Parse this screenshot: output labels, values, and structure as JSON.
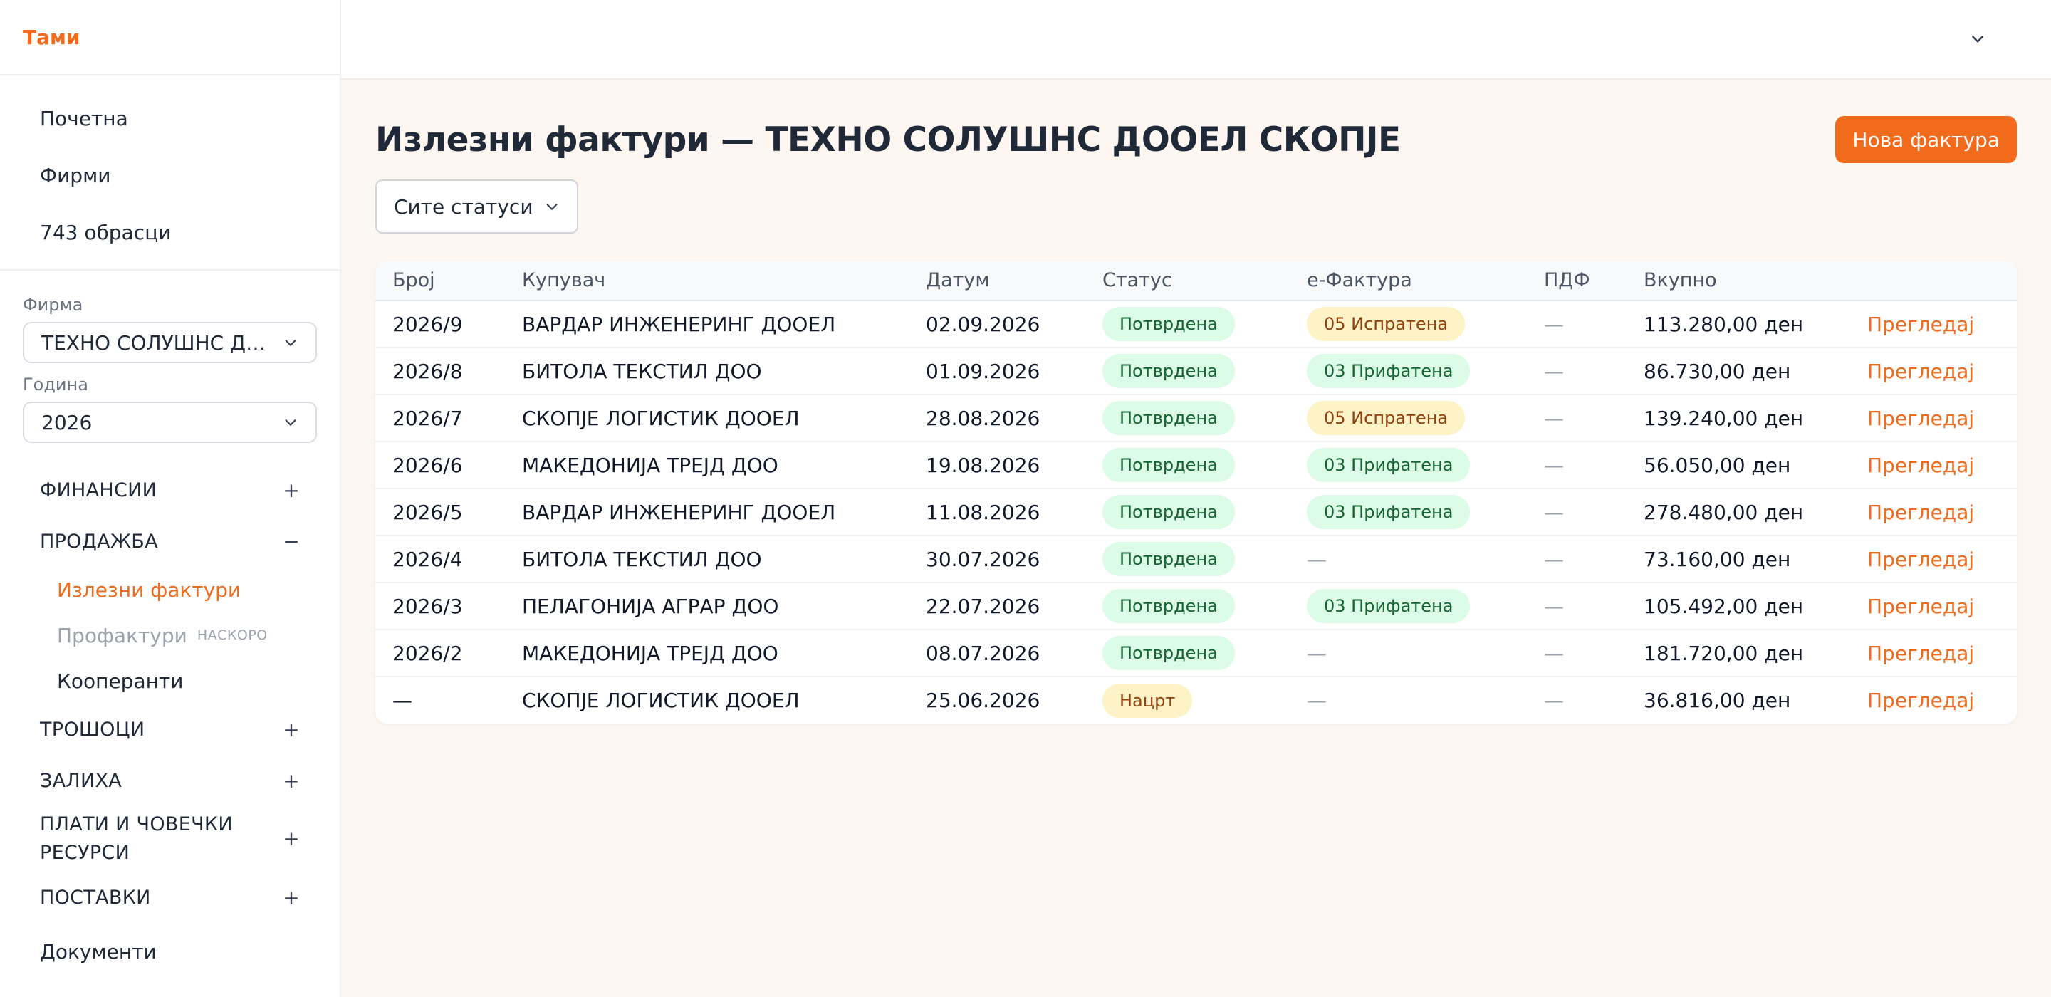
{
  "brand": "Тами",
  "nav": {
    "home": "Почетна",
    "companies": "Фирми",
    "forms": "743 обрасци"
  },
  "filters": {
    "company_label": "Фирма",
    "company_value": "ТЕХНО СОЛУШНС ДООЕЛ СКОПЈЕ",
    "year_label": "Година",
    "year_value": "2026"
  },
  "sections": {
    "finance": "ФИНАНСИИ",
    "sales": "ПРОДАЖБА",
    "expenses": "ТРОШОЦИ",
    "inventory": "ЗАЛИХА",
    "payroll": "ПЛАТИ И ЧОВЕЧКИ РЕСУРСИ",
    "supplies": "ПОСТАВКИ",
    "plus": "+",
    "minus": "−"
  },
  "sales_items": {
    "outgoing": "Излезни фактури",
    "proforma": "Профактури",
    "soon": "НАСКОРО",
    "partners": "Кооперанти"
  },
  "documents": "Документи",
  "main": {
    "title": "Излезни фактури — ТЕХНО СОЛУШНС ДООЕЛ СКОПЈЕ",
    "new_button": "Нова фактура",
    "status_filter": "Сите статуси"
  },
  "table": {
    "columns": [
      "Број",
      "Купувач",
      "Датум",
      "Статус",
      "е-Фактура",
      "ПДФ",
      "Вкупно",
      ""
    ],
    "rows": [
      {
        "number": "2026/9",
        "buyer": "ВАРДАР ИНЖЕНЕРИНГ ДООЕЛ",
        "date": "02.09.2026",
        "status": "Потврдена",
        "status_color": "green",
        "efaktura": "05 Испратена",
        "efaktura_color": "yellow",
        "pdf": "—",
        "total": "113.280,00 ден",
        "action": "Прегледај"
      },
      {
        "number": "2026/8",
        "buyer": "БИТОЛА ТЕКСТИЛ ДОО",
        "date": "01.09.2026",
        "status": "Потврдена",
        "status_color": "green",
        "efaktura": "03 Прифатена",
        "efaktura_color": "green",
        "pdf": "—",
        "total": "86.730,00 ден",
        "action": "Прегледај"
      },
      {
        "number": "2026/7",
        "buyer": "СКОПЈЕ ЛОГИСТИК ДООЕЛ",
        "date": "28.08.2026",
        "status": "Потврдена",
        "status_color": "green",
        "efaktura": "05 Испратена",
        "efaktura_color": "yellow",
        "pdf": "—",
        "total": "139.240,00 ден",
        "action": "Прегледај"
      },
      {
        "number": "2026/6",
        "buyer": "МАКЕДОНИЈА ТРЕЈД ДОО",
        "date": "19.08.2026",
        "status": "Потврдена",
        "status_color": "green",
        "efaktura": "03 Прифатена",
        "efaktura_color": "green",
        "pdf": "—",
        "total": "56.050,00 ден",
        "action": "Прегледај"
      },
      {
        "number": "2026/5",
        "buyer": "ВАРДАР ИНЖЕНЕРИНГ ДООЕЛ",
        "date": "11.08.2026",
        "status": "Потврдена",
        "status_color": "green",
        "efaktura": "03 Прифатена",
        "efaktura_color": "green",
        "pdf": "—",
        "total": "278.480,00 ден",
        "action": "Прегледај"
      },
      {
        "number": "2026/4",
        "buyer": "БИТОЛА ТЕКСТИЛ ДОО",
        "date": "30.07.2026",
        "status": "Потврдена",
        "status_color": "green",
        "efaktura": "—",
        "efaktura_color": "",
        "pdf": "—",
        "total": "73.160,00 ден",
        "action": "Прегледај"
      },
      {
        "number": "2026/3",
        "buyer": "ПЕЛАГОНИЈА АГРАР ДОО",
        "date": "22.07.2026",
        "status": "Потврдена",
        "status_color": "green",
        "efaktura": "03 Прифатена",
        "efaktura_color": "green",
        "pdf": "—",
        "total": "105.492,00 ден",
        "action": "Прегледај"
      },
      {
        "number": "2026/2",
        "buyer": "МАКЕДОНИЈА ТРЕЈД ДОО",
        "date": "08.07.2026",
        "status": "Потврдена",
        "status_color": "green",
        "efaktura": "—",
        "efaktura_color": "",
        "pdf": "—",
        "total": "181.720,00 ден",
        "action": "Прегледај"
      },
      {
        "number": "—",
        "buyer": "СКОПЈЕ ЛОГИСТИК ДООЕЛ",
        "date": "25.06.2026",
        "status": "Нацрт",
        "status_color": "yellow",
        "efaktura": "—",
        "efaktura_color": "",
        "pdf": "—",
        "total": "36.816,00 ден",
        "action": "Прегледај"
      }
    ]
  },
  "colors": {
    "accent": "#f26b1d",
    "page_bg": "#fdf6f1",
    "badge_green_bg": "#dcfce7",
    "badge_yellow_bg": "#fef3c7"
  },
  "icons": {
    "select": "chevron-down-icon",
    "topbar": "chevron-down-icon",
    "expand": "plus-icon",
    "collapse": "minus-icon"
  }
}
